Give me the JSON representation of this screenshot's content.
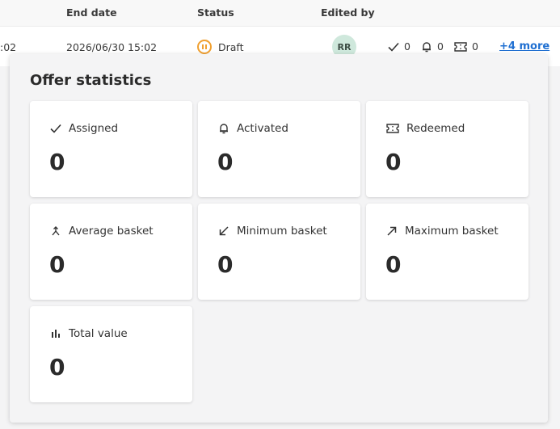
{
  "table": {
    "headers": {
      "end_date": "End date",
      "status": "Status",
      "edited_by": "Edited by"
    },
    "row": {
      "start_date_partial": ":02",
      "end_date": "2026/06/30 15:02",
      "status": "Draft",
      "editor_initials": "RR",
      "assigned_count": "0",
      "activated_count": "0",
      "redeemed_count": "0",
      "more_link": "+4 more"
    }
  },
  "popover": {
    "title": "Offer statistics",
    "cards": [
      {
        "label": "Assigned",
        "value": "0",
        "icon": "check-icon"
      },
      {
        "label": "Activated",
        "value": "0",
        "icon": "bell-icon"
      },
      {
        "label": "Redeemed",
        "value": "0",
        "icon": "ticket-icon"
      },
      {
        "label": "Average basket",
        "value": "0",
        "icon": "merge-arrow-icon"
      },
      {
        "label": "Minimum basket",
        "value": "0",
        "icon": "arrow-down-left-icon"
      },
      {
        "label": "Maximum basket",
        "value": "0",
        "icon": "arrow-up-right-icon"
      },
      {
        "label": "Total value",
        "value": "0",
        "icon": "bar-chart-icon"
      }
    ]
  },
  "colors": {
    "status_draft": "#f0a030",
    "link": "#1f6fd1",
    "avatar_bg": "#cfe8dc"
  }
}
